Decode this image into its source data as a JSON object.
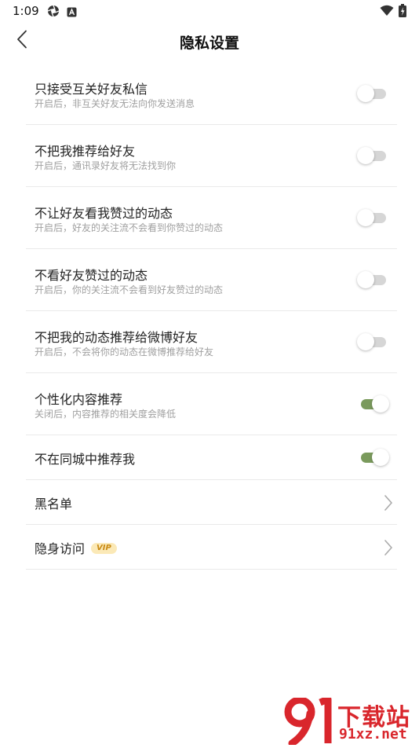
{
  "status_bar": {
    "time": "1:09",
    "app_icon_1": "camera-aperture-icon",
    "app_icon_2": "a-badge-icon",
    "wifi_icon": "wifi-icon",
    "battery_icon": "battery-charging-icon"
  },
  "nav": {
    "back_icon": "chevron-left-icon",
    "title": "隐私设置"
  },
  "settings": [
    {
      "title": "只接受互关好友私信",
      "subtitle": "开启后，非互关好友无法向你发送消息",
      "toggle_on": false
    },
    {
      "title": "不把我推荐给好友",
      "subtitle": "开启后，通讯录好友将无法找到你",
      "toggle_on": false
    },
    {
      "title": "不让好友看我赞过的动态",
      "subtitle": "开启后，好友的关注流不会看到你赞过的动态",
      "toggle_on": false
    },
    {
      "title": "不看好友赞过的动态",
      "subtitle": "开启后，你的关注流不会看到好友赞过的动态",
      "toggle_on": false
    },
    {
      "title": "不把我的动态推荐给微博好友",
      "subtitle": "开启后，不会将你的动态在微博推荐给好友",
      "toggle_on": false
    },
    {
      "title": "个性化内容推荐",
      "subtitle": "关闭后，内容推荐的相关度会降低",
      "toggle_on": true
    },
    {
      "title": "不在同城中推荐我",
      "toggle_on": true
    }
  ],
  "links": {
    "blacklist": {
      "title": "黑名单",
      "icon": "chevron-right-icon"
    },
    "invisible_visit": {
      "title": "隐身访问",
      "badge": "VIP",
      "icon": "chevron-right-icon"
    }
  },
  "watermark": {
    "logo": "91-logo-icon",
    "title": "下载站",
    "url": "91xz.net"
  },
  "colors": {
    "toggle_on": "#7a9a5c",
    "toggle_off": "#d6d6d6",
    "vip_badge_bg": "#fbe9b7",
    "vip_badge_text": "#c98a14",
    "watermark": "#d9262c"
  }
}
